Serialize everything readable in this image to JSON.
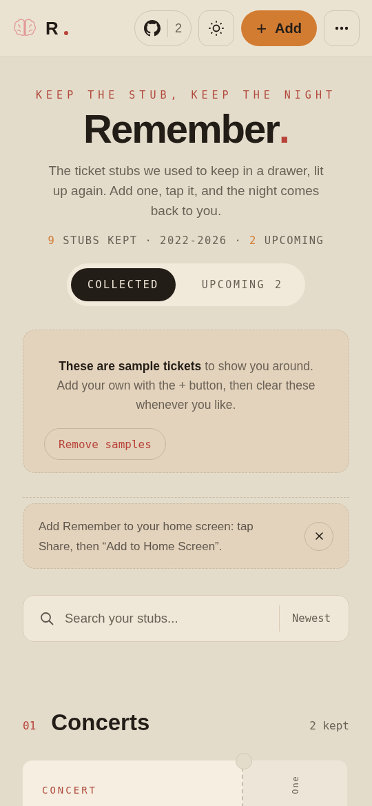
{
  "header": {
    "brand": "R",
    "github_count": "2",
    "add_button": "Add",
    "plus": "+"
  },
  "hero": {
    "kicker": "KEEP THE STUB, KEEP THE NIGHT",
    "title": "Remember",
    "title_dot": ".",
    "intro": "The ticket stubs we used to keep in a drawer, lit up again. Add one, tap it, and the night comes back to you.",
    "stats": [
      {
        "text": "9",
        "accent": true
      },
      {
        "text": "STUBS KEPT · 2022-2026 ·",
        "accent": false
      },
      {
        "text": "2",
        "accent": true
      },
      {
        "text": "UPCOMING",
        "accent": false
      }
    ]
  },
  "tabs": [
    {
      "label": "COLLECTED",
      "selected": true
    },
    {
      "label": "UPCOMING",
      "count": "2",
      "selected": false
    }
  ],
  "sample_notice": {
    "text": "**These are sample tickets** to show you around. Add your own with the + button, then clear these whenever you like.",
    "button": "Remove samples"
  },
  "install_notice": {
    "text": "Add Remember to your home screen: tap Share, then “Add to Home Screen”."
  },
  "search": {
    "placeholder": "Search your stubs...",
    "sort": "Newest"
  },
  "section": {
    "number": "01",
    "title": "Concerts",
    "count": "2 kept"
  },
  "ticket": {
    "category": "CONCERT",
    "stub": "One"
  }
}
